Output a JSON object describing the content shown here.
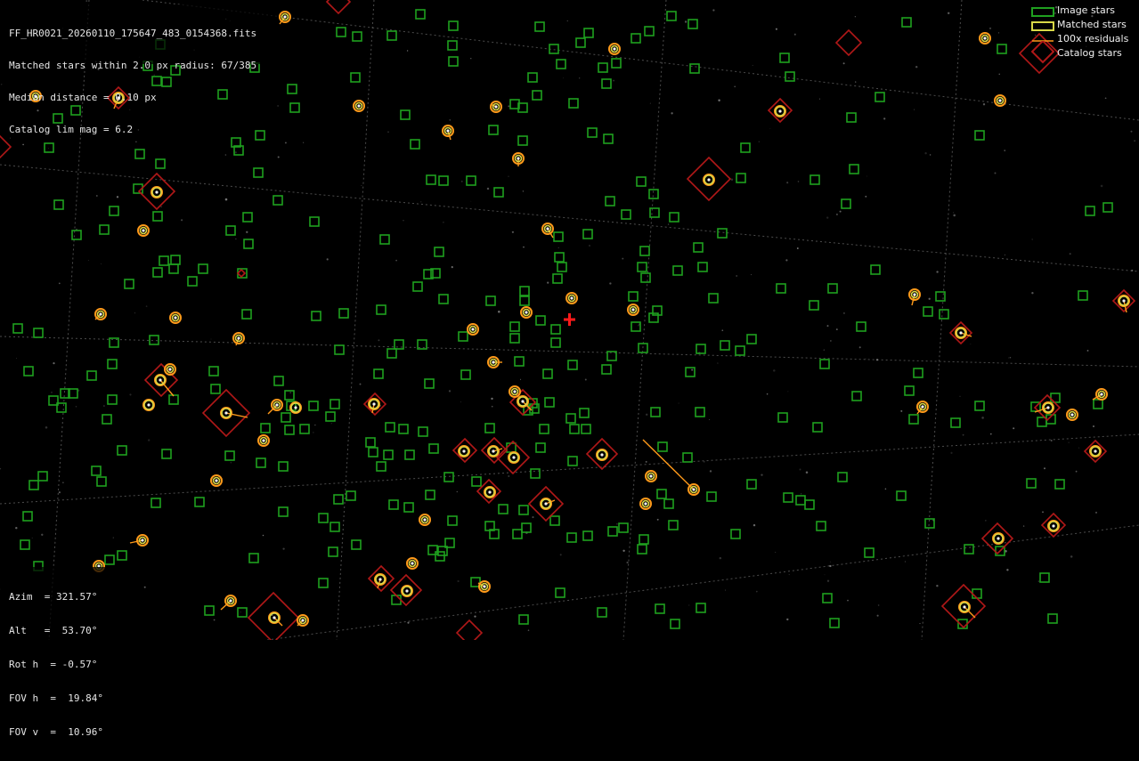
{
  "window": {
    "kind": "star field calibration view"
  },
  "info_top": {
    "lines": [
      "FF_HR0021_20260110_175647_483_0154368.fits",
      "Matched stars within 2.0 px radius: 67/385",
      "Median distance = 0.10 px",
      "Catalog lim mag = 6.2"
    ]
  },
  "info_bottom": {
    "lines": [
      "Azim  = 321.57°",
      "Alt   =  53.70°",
      "Rot h  = -0.57°",
      "FOV h  =  19.84°",
      "FOV v  =  10.96°"
    ]
  },
  "legend": {
    "items": [
      {
        "label": "Image stars",
        "swatch": "square-green-icon"
      },
      {
        "label": "Matched stars",
        "swatch": "square-yellow-icon"
      },
      {
        "label": "100x residuals",
        "swatch": "line-orange-icon"
      },
      {
        "label": "Catalog stars",
        "swatch": "diamond-red-icon"
      }
    ]
  },
  "colors": {
    "background": "#000000",
    "image_star": "#1fa01f",
    "matched_star": "#d8d848",
    "residual": "#ff9a1a",
    "catalog_star": "#b01818",
    "center_marker": "#ff1a1a",
    "grid": "#8a8a8a",
    "text": "#e6e6e6"
  }
}
